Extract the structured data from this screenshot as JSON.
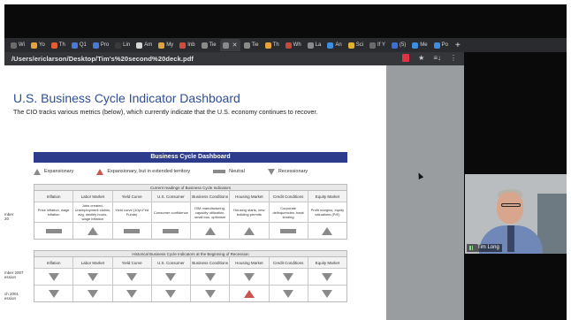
{
  "browser": {
    "tabs": [
      {
        "label": "Wi",
        "color": "#6b6b6b"
      },
      {
        "label": "Yo",
        "color": "#e9a23b"
      },
      {
        "label": "Th",
        "color": "#e25d33"
      },
      {
        "label": "Q1",
        "color": "#4a79d8"
      },
      {
        "label": "Pro",
        "color": "#4a79d8"
      },
      {
        "label": "Lin",
        "color": "#3a3a3a"
      },
      {
        "label": "Am",
        "color": "#d6d6d6"
      },
      {
        "label": "My",
        "color": "#e0a23a"
      },
      {
        "label": "Inb",
        "color": "#d44b3b"
      },
      {
        "label": "Tie",
        "color": "#8a8a8a"
      },
      {
        "label": "",
        "color": "#8a8a8a",
        "active": true,
        "close": "✕"
      },
      {
        "label": "Tie",
        "color": "#8a8a8a"
      },
      {
        "label": "Th",
        "color": "#e9a23b"
      },
      {
        "label": "Wh",
        "color": "#c04a3b"
      },
      {
        "label": "La",
        "color": "#8a8a8a"
      },
      {
        "label": "An",
        "color": "#3d8ede"
      },
      {
        "label": "Sci",
        "color": "#e0b030"
      },
      {
        "label": "If Y",
        "color": "#6b6b6b"
      },
      {
        "label": "(5)",
        "color": "#3b6fd8"
      },
      {
        "label": "Me",
        "color": "#3d8ede"
      },
      {
        "label": "Po",
        "color": "#3d8ede"
      }
    ],
    "new_tab": "+",
    "url": "/Users/ericlarson/Desktop/Tim's%20second%20deck.pdf",
    "tools": [
      "★",
      "≡↓",
      "⋮"
    ]
  },
  "slide": {
    "title": "U.S. Business Cycle Indicator Dashboard",
    "subtitle": "The CIO tracks various metrics (below), which currently indicate that the U.S. economy continues to recover.",
    "dashboard_title": "Business Cycle Dashboard",
    "legend": [
      "Expansionary",
      "Expansionary, but in extended territory",
      "Neutral",
      "Recessionary"
    ],
    "current": {
      "caption": "Current readings of Business Cycle Indicators",
      "side_label": [
        "mber",
        "20"
      ],
      "columns": [
        "Inflation",
        "Labor Market",
        "Yield Curve",
        "U.S. Consumer",
        "Business Conditions",
        "Housing Market",
        "Credit Conditions",
        "Equity Market"
      ],
      "descriptions": [
        "Price inflation, wage inflation",
        "Jobs created, Unemployment claims, avg. weekly hours, wage inflation",
        "Yield curve (10yr-Fed Funds)",
        "Consumer confidence",
        "ISM manufacturing, capacity utilization, small bus. optimism",
        "Housing starts, new building permits",
        "Corporate delinquencies, bank lending",
        "Profit margins, equity valuations (P/E)"
      ],
      "signals": [
        "neutral",
        "up",
        "neutral",
        "neutral",
        "up",
        "up",
        "neutral",
        "up"
      ]
    },
    "historical": {
      "caption": "Historical Business Cycle Indicators at the Beginning of Recession",
      "columns": [
        "Inflation",
        "Labor Market",
        "Yield Curve",
        "U.S. Consumer",
        "Business Conditions",
        "Housing Market",
        "Credit Conditions",
        "Equity Market"
      ],
      "rows": [
        {
          "label": [
            "mber 2007",
            "ession"
          ],
          "signals": [
            "down",
            "down",
            "down",
            "down",
            "down",
            "down",
            "down",
            "down"
          ]
        },
        {
          "label": [
            "ch 2001",
            "ession"
          ],
          "signals": [
            "down",
            "down",
            "down",
            "down",
            "down",
            "up-red",
            "down",
            "down"
          ]
        }
      ]
    }
  },
  "video": {
    "participant_name": "Tim Long"
  },
  "colors": {
    "accent_title": "#2e4e96",
    "dashboard_header": "#2c3b8c",
    "arrow_grey": "#8a8a8a",
    "arrow_red": "#c9554e"
  }
}
